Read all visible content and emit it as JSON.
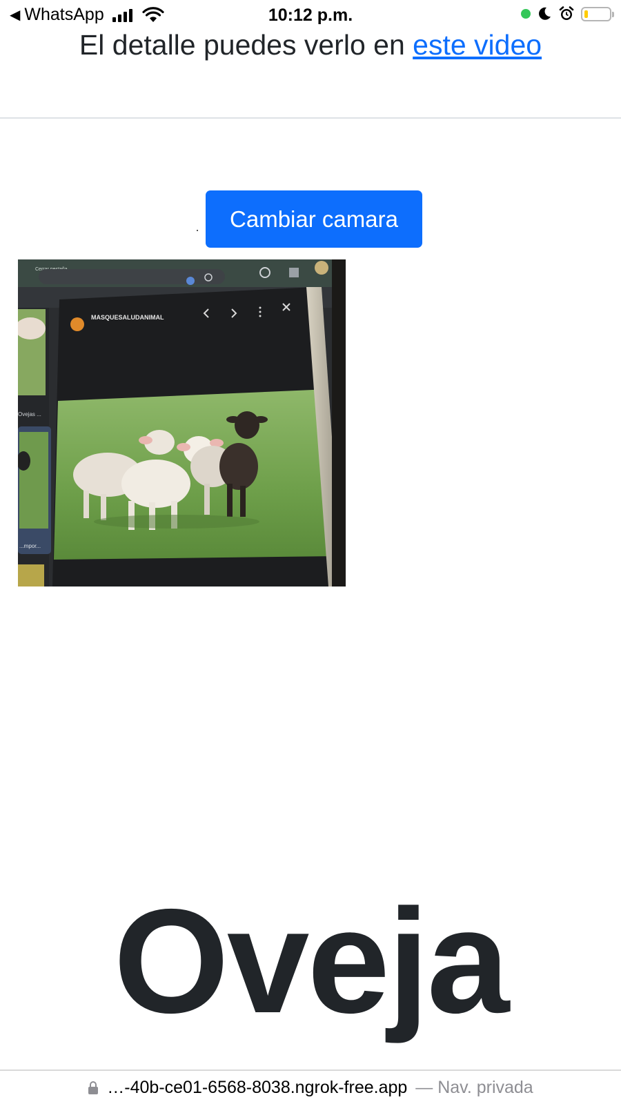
{
  "status_bar": {
    "back_app": "WhatsApp",
    "time": "10:12 p.m.",
    "battery_level": 0.15,
    "indicator_color": "#34c759"
  },
  "page": {
    "detail_text": "El detalle puedes verlo en",
    "video_link": "este video",
    "switch_camera_button": "Cambiar camara",
    "prediction": "Oveja",
    "accent_color": "#0d6efd"
  },
  "camera_feed": {
    "overlay_title": "MASQUESALUDANIMAL",
    "side_labels": [
      "Cerrar pestaña",
      "Ovejas ...",
      "...mpor..."
    ]
  },
  "url_bar": {
    "url": "…-40b-ce01-6568-8038.ngrok-free.app",
    "mode": "— Nav. privada"
  }
}
